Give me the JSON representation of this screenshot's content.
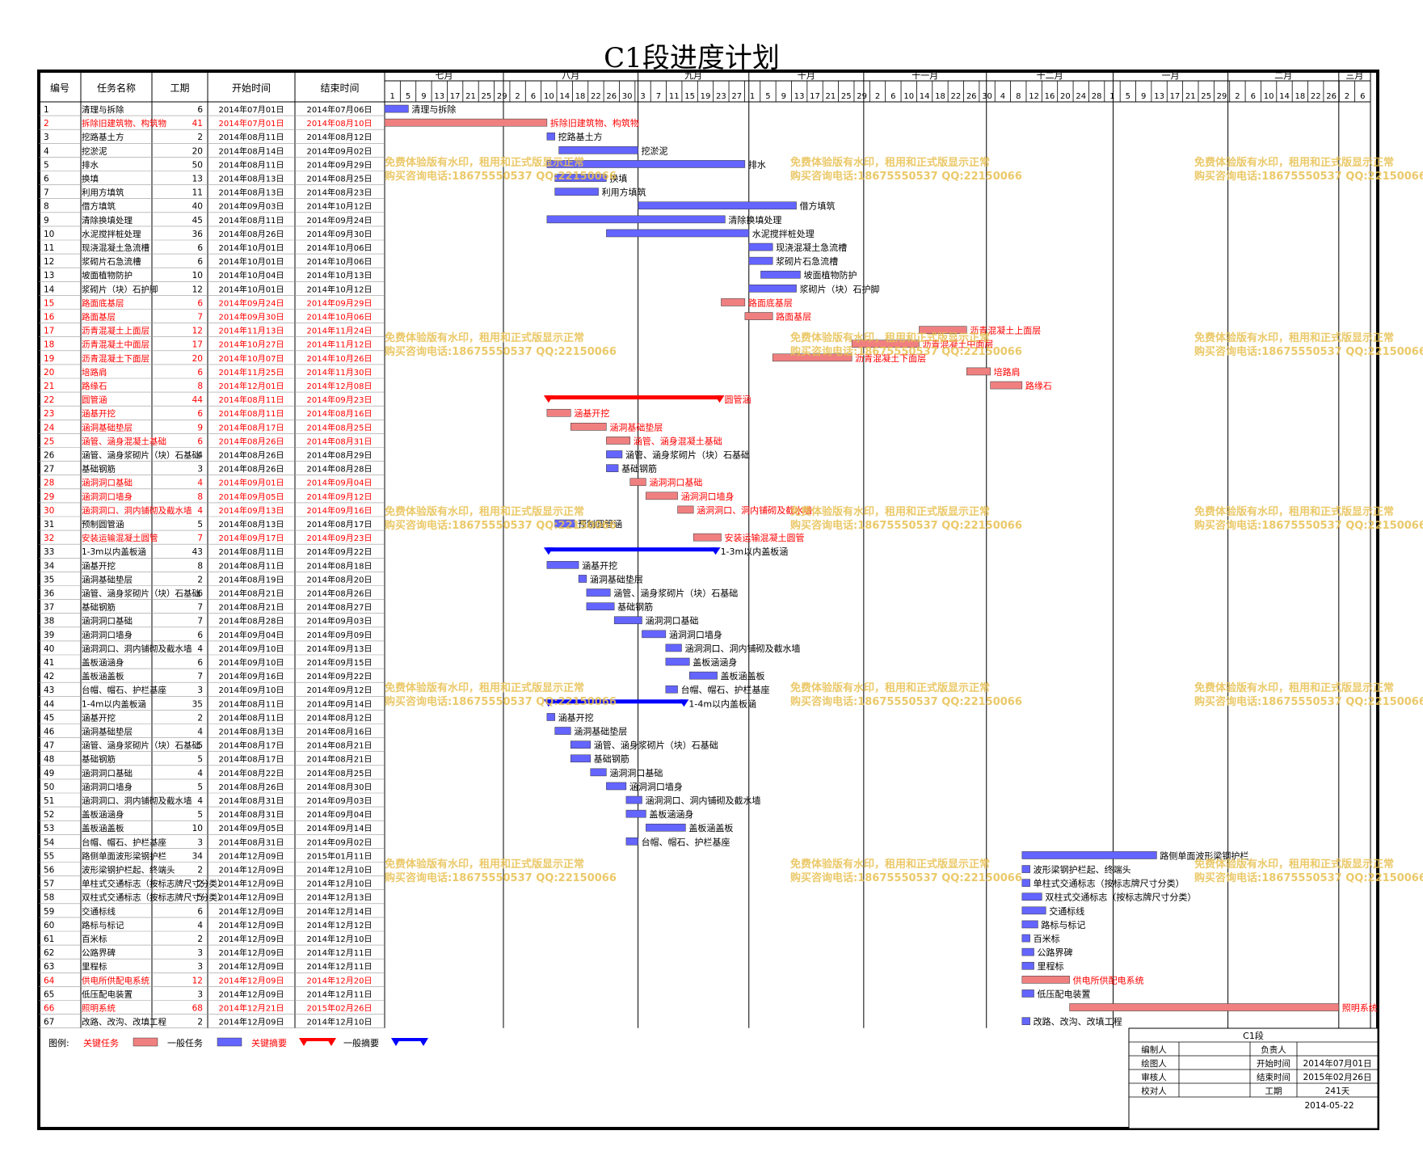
{
  "title": "C1段进度计划",
  "colors": {
    "critical_task": "#f08080",
    "normal_task": "#6464ff",
    "critical_summary": "#ff0000",
    "normal_summary": "#0000ff",
    "critical_text": "#ff0000",
    "link": "#0000ff",
    "watermark": "#e8c050"
  },
  "headers": {
    "id": "编号",
    "name": "任务名称",
    "duration": "工期",
    "start": "开始时间",
    "end": "结束时间"
  },
  "chart_data": {
    "type": "gantt",
    "title": "C1段进度计划",
    "axis_start": "2014-07-01",
    "axis_end": "2015-03-07",
    "months": [
      {
        "label": "七月",
        "start": "2014-07-01",
        "end": "2014-07-31"
      },
      {
        "label": "八月",
        "start": "2014-07-31",
        "end": "2014-09-03"
      },
      {
        "label": "九月",
        "start": "2014-09-03",
        "end": "2014-10-01"
      },
      {
        "label": "十月",
        "start": "2014-10-01",
        "end": "2014-10-30"
      },
      {
        "label": "十一月",
        "start": "2014-10-30",
        "end": "2014-11-30"
      },
      {
        "label": "十二月",
        "start": "2014-11-30",
        "end": "2015-01-01"
      },
      {
        "label": "一月",
        "start": "2015-01-01",
        "end": "2015-01-30"
      },
      {
        "label": "二月",
        "start": "2015-01-30",
        "end": "2015-02-27"
      },
      {
        "label": "三月",
        "start": "2015-02-27",
        "end": "2015-03-07"
      }
    ],
    "days": [
      "1",
      "5",
      "9",
      "13",
      "17",
      "21",
      "25",
      "29",
      "2",
      "6",
      "10",
      "14",
      "18",
      "22",
      "26",
      "30",
      "3",
      "7",
      "11",
      "15",
      "19",
      "23",
      "27",
      "1",
      "5",
      "9",
      "13",
      "17",
      "21",
      "25",
      "29",
      "2",
      "6",
      "10",
      "14",
      "18",
      "22",
      "26",
      "30",
      "4",
      "8",
      "12",
      "16",
      "20",
      "24",
      "28",
      "1",
      "5",
      "9",
      "13",
      "17",
      "21",
      "25",
      "29",
      "2",
      "6",
      "10",
      "14",
      "18",
      "22",
      "26",
      "2",
      "6"
    ],
    "tasks": [
      {
        "id": "1",
        "name": "清理与拆除",
        "dur": "6",
        "start": "2014年07月01日",
        "end": "2014年07月06日",
        "s": "2014-07-01",
        "e": "2014-07-06",
        "kind": "n",
        "label": "清理与拆除"
      },
      {
        "id": "2",
        "name": "拆除旧建筑物、构筑物",
        "dur": "41",
        "start": "2014年07月01日",
        "end": "2014年08月10日",
        "s": "2014-07-01",
        "e": "2014-08-10",
        "kind": "c",
        "label": "拆除旧建筑物、构筑物"
      },
      {
        "id": "3",
        "name": "挖路基土方",
        "dur": "2",
        "start": "2014年08月11日",
        "end": "2014年08月12日",
        "s": "2014-08-11",
        "e": "2014-08-12",
        "kind": "n",
        "label": "挖路基土方"
      },
      {
        "id": "4",
        "name": "挖淤泥",
        "dur": "20",
        "start": "2014年08月14日",
        "end": "2014年09月02日",
        "s": "2014-08-14",
        "e": "2014-09-02",
        "kind": "n",
        "label": "挖淤泥"
      },
      {
        "id": "5",
        "name": "排水",
        "dur": "50",
        "start": "2014年08月11日",
        "end": "2014年09月29日",
        "s": "2014-08-11",
        "e": "2014-09-29",
        "kind": "n",
        "label": "排水"
      },
      {
        "id": "6",
        "name": "换填",
        "dur": "13",
        "start": "2014年08月13日",
        "end": "2014年08月25日",
        "s": "2014-08-13",
        "e": "2014-08-25",
        "kind": "n",
        "label": "换填"
      },
      {
        "id": "7",
        "name": "利用方填筑",
        "dur": "11",
        "start": "2014年08月13日",
        "end": "2014年08月23日",
        "s": "2014-08-13",
        "e": "2014-08-23",
        "kind": "n",
        "label": "利用方填筑"
      },
      {
        "id": "8",
        "name": "借方填筑",
        "dur": "40",
        "start": "2014年09月03日",
        "end": "2014年10月12日",
        "s": "2014-09-03",
        "e": "2014-10-12",
        "kind": "n",
        "label": "借方填筑"
      },
      {
        "id": "9",
        "name": "清除换填处理",
        "dur": "45",
        "start": "2014年08月11日",
        "end": "2014年09月24日",
        "s": "2014-08-11",
        "e": "2014-09-24",
        "kind": "n",
        "label": "清除换填处理"
      },
      {
        "id": "10",
        "name": "水泥搅拌桩处理",
        "dur": "36",
        "start": "2014年08月26日",
        "end": "2014年09月30日",
        "s": "2014-08-26",
        "e": "2014-09-30",
        "kind": "n",
        "label": "水泥搅拌桩处理"
      },
      {
        "id": "11",
        "name": "现浇混凝土急流槽",
        "dur": "6",
        "start": "2014年10月01日",
        "end": "2014年10月06日",
        "s": "2014-10-01",
        "e": "2014-10-06",
        "kind": "n",
        "label": "现浇混凝土急流槽"
      },
      {
        "id": "12",
        "name": "浆砌片石急流槽",
        "dur": "6",
        "start": "2014年10月01日",
        "end": "2014年10月06日",
        "s": "2014-10-01",
        "e": "2014-10-06",
        "kind": "n",
        "label": "浆砌片石急流槽"
      },
      {
        "id": "13",
        "name": "坡面植物防护",
        "dur": "10",
        "start": "2014年10月04日",
        "end": "2014年10月13日",
        "s": "2014-10-04",
        "e": "2014-10-13",
        "kind": "n",
        "label": "坡面植物防护"
      },
      {
        "id": "14",
        "name": "浆砌片（块）石护脚",
        "dur": "12",
        "start": "2014年10月01日",
        "end": "2014年10月12日",
        "s": "2014-10-01",
        "e": "2014-10-12",
        "kind": "n",
        "label": "浆砌片（块）石护脚"
      },
      {
        "id": "15",
        "name": "路面底基层",
        "dur": "6",
        "start": "2014年09月24日",
        "end": "2014年09月29日",
        "s": "2014-09-24",
        "e": "2014-09-29",
        "kind": "c",
        "label": "路面底基层"
      },
      {
        "id": "16",
        "name": "路面基层",
        "dur": "7",
        "start": "2014年09月30日",
        "end": "2014年10月06日",
        "s": "2014-09-30",
        "e": "2014-10-06",
        "kind": "c",
        "label": "路面基层"
      },
      {
        "id": "17",
        "name": "沥青混凝土上面层",
        "dur": "12",
        "start": "2014年11月13日",
        "end": "2014年11月24日",
        "s": "2014-11-13",
        "e": "2014-11-24",
        "kind": "c",
        "label": "沥青混凝土上面层"
      },
      {
        "id": "18",
        "name": "沥青混凝土中面层",
        "dur": "17",
        "start": "2014年10月27日",
        "end": "2014年11月12日",
        "s": "2014-10-27",
        "e": "2014-11-12",
        "kind": "c",
        "label": "沥青混凝土中面层"
      },
      {
        "id": "19",
        "name": "沥青混凝土下面层",
        "dur": "20",
        "start": "2014年10月07日",
        "end": "2014年10月26日",
        "s": "2014-10-07",
        "e": "2014-10-26",
        "kind": "c",
        "label": "沥青混凝土下面层"
      },
      {
        "id": "20",
        "name": "培路肩",
        "dur": "6",
        "start": "2014年11月25日",
        "end": "2014年11月30日",
        "s": "2014-11-25",
        "e": "2014-11-30",
        "kind": "c",
        "label": "培路肩"
      },
      {
        "id": "21",
        "name": "路缘石",
        "dur": "8",
        "start": "2014年12月01日",
        "end": "2014年12月08日",
        "s": "2014-12-01",
        "e": "2014-12-08",
        "kind": "c",
        "label": "路缘石"
      },
      {
        "id": "22",
        "name": "圆管涵",
        "dur": "44",
        "start": "2014年08月11日",
        "end": "2014年09月23日",
        "s": "2014-08-11",
        "e": "2014-09-23",
        "kind": "cs",
        "label": "圆管涵"
      },
      {
        "id": "23",
        "name": "涵基开挖",
        "dur": "6",
        "start": "2014年08月11日",
        "end": "2014年08月16日",
        "s": "2014-08-11",
        "e": "2014-08-16",
        "kind": "c",
        "label": "涵基开挖"
      },
      {
        "id": "24",
        "name": "涵洞基础垫层",
        "dur": "9",
        "start": "2014年08月17日",
        "end": "2014年08月25日",
        "s": "2014-08-17",
        "e": "2014-08-25",
        "kind": "c",
        "label": "涵洞基础垫层"
      },
      {
        "id": "25",
        "name": "涵管、涵身混凝土基础",
        "dur": "6",
        "start": "2014年08月26日",
        "end": "2014年08月31日",
        "s": "2014-08-26",
        "e": "2014-08-31",
        "kind": "c",
        "label": "涵管、涵身混凝土基础"
      },
      {
        "id": "26",
        "name": "涵管、涵身浆砌片（块）石基础",
        "dur": "4",
        "start": "2014年08月26日",
        "end": "2014年08月29日",
        "s": "2014-08-26",
        "e": "2014-08-29",
        "kind": "n",
        "label": "涵管、涵身浆砌片（块）石基础"
      },
      {
        "id": "27",
        "name": "基础钢筋",
        "dur": "3",
        "start": "2014年08月26日",
        "end": "2014年08月28日",
        "s": "2014-08-26",
        "e": "2014-08-28",
        "kind": "n",
        "label": "基础钢筋"
      },
      {
        "id": "28",
        "name": "涵洞洞口基础",
        "dur": "4",
        "start": "2014年09月01日",
        "end": "2014年09月04日",
        "s": "2014-09-01",
        "e": "2014-09-04",
        "kind": "c",
        "label": "涵洞洞口基础"
      },
      {
        "id": "29",
        "name": "涵洞洞口墙身",
        "dur": "8",
        "start": "2014年09月05日",
        "end": "2014年09月12日",
        "s": "2014-09-05",
        "e": "2014-09-12",
        "kind": "c",
        "label": "涵洞洞口墙身"
      },
      {
        "id": "30",
        "name": "涵洞洞口、洞内铺砌及截水墙",
        "dur": "4",
        "start": "2014年09月13日",
        "end": "2014年09月16日",
        "s": "2014-09-13",
        "e": "2014-09-16",
        "kind": "c",
        "label": "涵洞洞口、洞内铺砌及截水墙"
      },
      {
        "id": "31",
        "name": "预制圆管涵",
        "dur": "5",
        "start": "2014年08月13日",
        "end": "2014年08月17日",
        "s": "2014-08-13",
        "e": "2014-08-17",
        "kind": "n",
        "label": "预制圆管涵"
      },
      {
        "id": "32",
        "name": "安装运输混凝土圆管",
        "dur": "7",
        "start": "2014年09月17日",
        "end": "2014年09月23日",
        "s": "2014-09-17",
        "e": "2014-09-23",
        "kind": "c",
        "label": "安装运输混凝土圆管"
      },
      {
        "id": "33",
        "name": "1-3m以内盖板涵",
        "dur": "43",
        "start": "2014年08月11日",
        "end": "2014年09月22日",
        "s": "2014-08-11",
        "e": "2014-09-22",
        "kind": "ns",
        "label": "1-3m以内盖板涵"
      },
      {
        "id": "34",
        "name": "涵基开挖",
        "dur": "8",
        "start": "2014年08月11日",
        "end": "2014年08月18日",
        "s": "2014-08-11",
        "e": "2014-08-18",
        "kind": "n",
        "label": "涵基开挖"
      },
      {
        "id": "35",
        "name": "涵洞基础垫层",
        "dur": "2",
        "start": "2014年08月19日",
        "end": "2014年08月20日",
        "s": "2014-08-19",
        "e": "2014-08-20",
        "kind": "n",
        "label": "涵洞基础垫层"
      },
      {
        "id": "36",
        "name": "涵管、涵身浆砌片（块）石基础",
        "dur": "6",
        "start": "2014年08月21日",
        "end": "2014年08月26日",
        "s": "2014-08-21",
        "e": "2014-08-26",
        "kind": "n",
        "label": "涵管、涵身浆砌片（块）石基础"
      },
      {
        "id": "37",
        "name": "基础钢筋",
        "dur": "7",
        "start": "2014年08月21日",
        "end": "2014年08月27日",
        "s": "2014-08-21",
        "e": "2014-08-27",
        "kind": "n",
        "label": "基础钢筋"
      },
      {
        "id": "38",
        "name": "涵洞洞口基础",
        "dur": "7",
        "start": "2014年08月28日",
        "end": "2014年09月03日",
        "s": "2014-08-28",
        "e": "2014-09-03",
        "kind": "n",
        "label": "涵洞洞口基础"
      },
      {
        "id": "39",
        "name": "涵洞洞口墙身",
        "dur": "6",
        "start": "2014年09月04日",
        "end": "2014年09月09日",
        "s": "2014-09-04",
        "e": "2014-09-09",
        "kind": "n",
        "label": "涵洞洞口墙身"
      },
      {
        "id": "40",
        "name": "涵洞洞口、洞内铺砌及截水墙",
        "dur": "4",
        "start": "2014年09月10日",
        "end": "2014年09月13日",
        "s": "2014-09-10",
        "e": "2014-09-13",
        "kind": "n",
        "label": "涵洞洞口、洞内铺砌及截水墙"
      },
      {
        "id": "41",
        "name": "盖板涵涵身",
        "dur": "6",
        "start": "2014年09月10日",
        "end": "2014年09月15日",
        "s": "2014-09-10",
        "e": "2014-09-15",
        "kind": "n",
        "label": "盖板涵涵身"
      },
      {
        "id": "42",
        "name": "盖板涵盖板",
        "dur": "7",
        "start": "2014年09月16日",
        "end": "2014年09月22日",
        "s": "2014-09-16",
        "e": "2014-09-22",
        "kind": "n",
        "label": "盖板涵盖板"
      },
      {
        "id": "43",
        "name": "台帽、帽石、护栏基座",
        "dur": "3",
        "start": "2014年09月10日",
        "end": "2014年09月12日",
        "s": "2014-09-10",
        "e": "2014-09-12",
        "kind": "n",
        "label": "台帽、帽石、护栏基座"
      },
      {
        "id": "44",
        "name": "1-4m以内盖板涵",
        "dur": "35",
        "start": "2014年08月11日",
        "end": "2014年09月14日",
        "s": "2014-08-11",
        "e": "2014-09-14",
        "kind": "ns",
        "label": "1-4m以内盖板涵"
      },
      {
        "id": "45",
        "name": "涵基开挖",
        "dur": "2",
        "start": "2014年08月11日",
        "end": "2014年08月12日",
        "s": "2014-08-11",
        "e": "2014-08-12",
        "kind": "n",
        "label": "涵基开挖"
      },
      {
        "id": "46",
        "name": "涵洞基础垫层",
        "dur": "4",
        "start": "2014年08月13日",
        "end": "2014年08月16日",
        "s": "2014-08-13",
        "e": "2014-08-16",
        "kind": "n",
        "label": "涵洞基础垫层"
      },
      {
        "id": "47",
        "name": "涵管、涵身浆砌片（块）石基础",
        "dur": "5",
        "start": "2014年08月17日",
        "end": "2014年08月21日",
        "s": "2014-08-17",
        "e": "2014-08-21",
        "kind": "n",
        "label": "涵管、涵身浆砌片（块）石基础"
      },
      {
        "id": "48",
        "name": "基础钢筋",
        "dur": "5",
        "start": "2014年08月17日",
        "end": "2014年08月21日",
        "s": "2014-08-17",
        "e": "2014-08-21",
        "kind": "n",
        "label": "基础钢筋"
      },
      {
        "id": "49",
        "name": "涵洞洞口基础",
        "dur": "4",
        "start": "2014年08月22日",
        "end": "2014年08月25日",
        "s": "2014-08-22",
        "e": "2014-08-25",
        "kind": "n",
        "label": "涵洞洞口基础"
      },
      {
        "id": "50",
        "name": "涵洞洞口墙身",
        "dur": "5",
        "start": "2014年08月26日",
        "end": "2014年08月30日",
        "s": "2014-08-26",
        "e": "2014-08-30",
        "kind": "n",
        "label": "涵洞洞口墙身"
      },
      {
        "id": "51",
        "name": "涵洞洞口、洞内铺砌及截水墙",
        "dur": "4",
        "start": "2014年08月31日",
        "end": "2014年09月03日",
        "s": "2014-08-31",
        "e": "2014-09-03",
        "kind": "n",
        "label": "涵洞洞口、洞内铺砌及截水墙"
      },
      {
        "id": "52",
        "name": "盖板涵涵身",
        "dur": "5",
        "start": "2014年08月31日",
        "end": "2014年09月04日",
        "s": "2014-08-31",
        "e": "2014-09-04",
        "kind": "n",
        "label": "盖板涵涵身"
      },
      {
        "id": "53",
        "name": "盖板涵盖板",
        "dur": "10",
        "start": "2014年09月05日",
        "end": "2014年09月14日",
        "s": "2014-09-05",
        "e": "2014-09-14",
        "kind": "n",
        "label": "盖板涵盖板"
      },
      {
        "id": "54",
        "name": "台帽、帽石、护栏基座",
        "dur": "3",
        "start": "2014年08月31日",
        "end": "2014年09月02日",
        "s": "2014-08-31",
        "e": "2014-09-02",
        "kind": "n",
        "label": "台帽、帽石、护栏基座"
      },
      {
        "id": "55",
        "name": "路侧单面波形梁钢护栏",
        "dur": "34",
        "start": "2014年12月09日",
        "end": "2015年01月11日",
        "s": "2014-12-09",
        "e": "2015-01-11",
        "kind": "n",
        "label": "路侧单面波形梁钢护栏"
      },
      {
        "id": "56",
        "name": "波形梁钢护栏起、终端头",
        "dur": "2",
        "start": "2014年12月09日",
        "end": "2014年12月10日",
        "s": "2014-12-09",
        "e": "2014-12-10",
        "kind": "n",
        "label": "波形梁钢护栏起、终端头"
      },
      {
        "id": "57",
        "name": "单柱式交通标志（按标志牌尺寸分类）",
        "dur": "2",
        "start": "2014年12月09日",
        "end": "2014年12月10日",
        "s": "2014-12-09",
        "e": "2014-12-10",
        "kind": "n",
        "label": "单柱式交通标志（按标志牌尺寸分类）"
      },
      {
        "id": "58",
        "name": "双柱式交通标志（按标志牌尺寸分类）",
        "dur": "5",
        "start": "2014年12月09日",
        "end": "2014年12月13日",
        "s": "2014-12-09",
        "e": "2014-12-13",
        "kind": "n",
        "label": "双柱式交通标志（按标志牌尺寸分类）"
      },
      {
        "id": "59",
        "name": "交通标线",
        "dur": "6",
        "start": "2014年12月09日",
        "end": "2014年12月14日",
        "s": "2014-12-09",
        "e": "2014-12-14",
        "kind": "n",
        "label": "交通标线"
      },
      {
        "id": "60",
        "name": "路标与标记",
        "dur": "4",
        "start": "2014年12月09日",
        "end": "2014年12月12日",
        "s": "2014-12-09",
        "e": "2014-12-12",
        "kind": "n",
        "label": "路标与标记"
      },
      {
        "id": "61",
        "name": "百米标",
        "dur": "2",
        "start": "2014年12月09日",
        "end": "2014年12月10日",
        "s": "2014-12-09",
        "e": "2014-12-10",
        "kind": "n",
        "label": "百米标"
      },
      {
        "id": "62",
        "name": "公路界碑",
        "dur": "3",
        "start": "2014年12月09日",
        "end": "2014年12月11日",
        "s": "2014-12-09",
        "e": "2014-12-11",
        "kind": "n",
        "label": "公路界碑"
      },
      {
        "id": "63",
        "name": "里程标",
        "dur": "3",
        "start": "2014年12月09日",
        "end": "2014年12月11日",
        "s": "2014-12-09",
        "e": "2014-12-11",
        "kind": "n",
        "label": "里程标"
      },
      {
        "id": "64",
        "name": "供电所供配电系统",
        "dur": "12",
        "start": "2014年12月09日",
        "end": "2014年12月20日",
        "s": "2014-12-09",
        "e": "2014-12-20",
        "kind": "c",
        "label": "供电所供配电系统"
      },
      {
        "id": "65",
        "name": "低压配电装置",
        "dur": "3",
        "start": "2014年12月09日",
        "end": "2014年12月11日",
        "s": "2014-12-09",
        "e": "2014-12-11",
        "kind": "n",
        "label": "低压配电装置"
      },
      {
        "id": "66",
        "name": "照明系统",
        "dur": "68",
        "start": "2014年12月21日",
        "end": "2015年02月26日",
        "s": "2014-12-21",
        "e": "2015-02-26",
        "kind": "c",
        "label": "照明系统"
      },
      {
        "id": "67",
        "name": "改路、改沟、改填工程",
        "dur": "2",
        "start": "2014年12月09日",
        "end": "2014年12月10日",
        "s": "2014-12-09",
        "e": "2014-12-10",
        "kind": "n",
        "label": "改路、改沟、改填工程"
      }
    ]
  },
  "watermark": {
    "line1": "免费体验版有水印，租用和正式版显示正常",
    "line2": "购买咨询电话:18675550537 QQ:22150066"
  },
  "legend": {
    "title": "图例:",
    "items": [
      {
        "label": "关键任务",
        "kind": "c"
      },
      {
        "label": "一般任务",
        "kind": "n"
      },
      {
        "label": "关键摘要",
        "kind": "cs"
      },
      {
        "label": "一般摘要",
        "kind": "ns"
      }
    ]
  },
  "info_box": {
    "title": "C1段",
    "rows": [
      [
        "编制人",
        "",
        "负责人",
        ""
      ],
      [
        "绘图人",
        "",
        "开始时间",
        "2014年07月01日"
      ],
      [
        "审核人",
        "",
        "结束时间",
        "2015年02月26日"
      ],
      [
        "校对人",
        "",
        "工期",
        "241天"
      ]
    ],
    "date": "2014-05-22"
  }
}
